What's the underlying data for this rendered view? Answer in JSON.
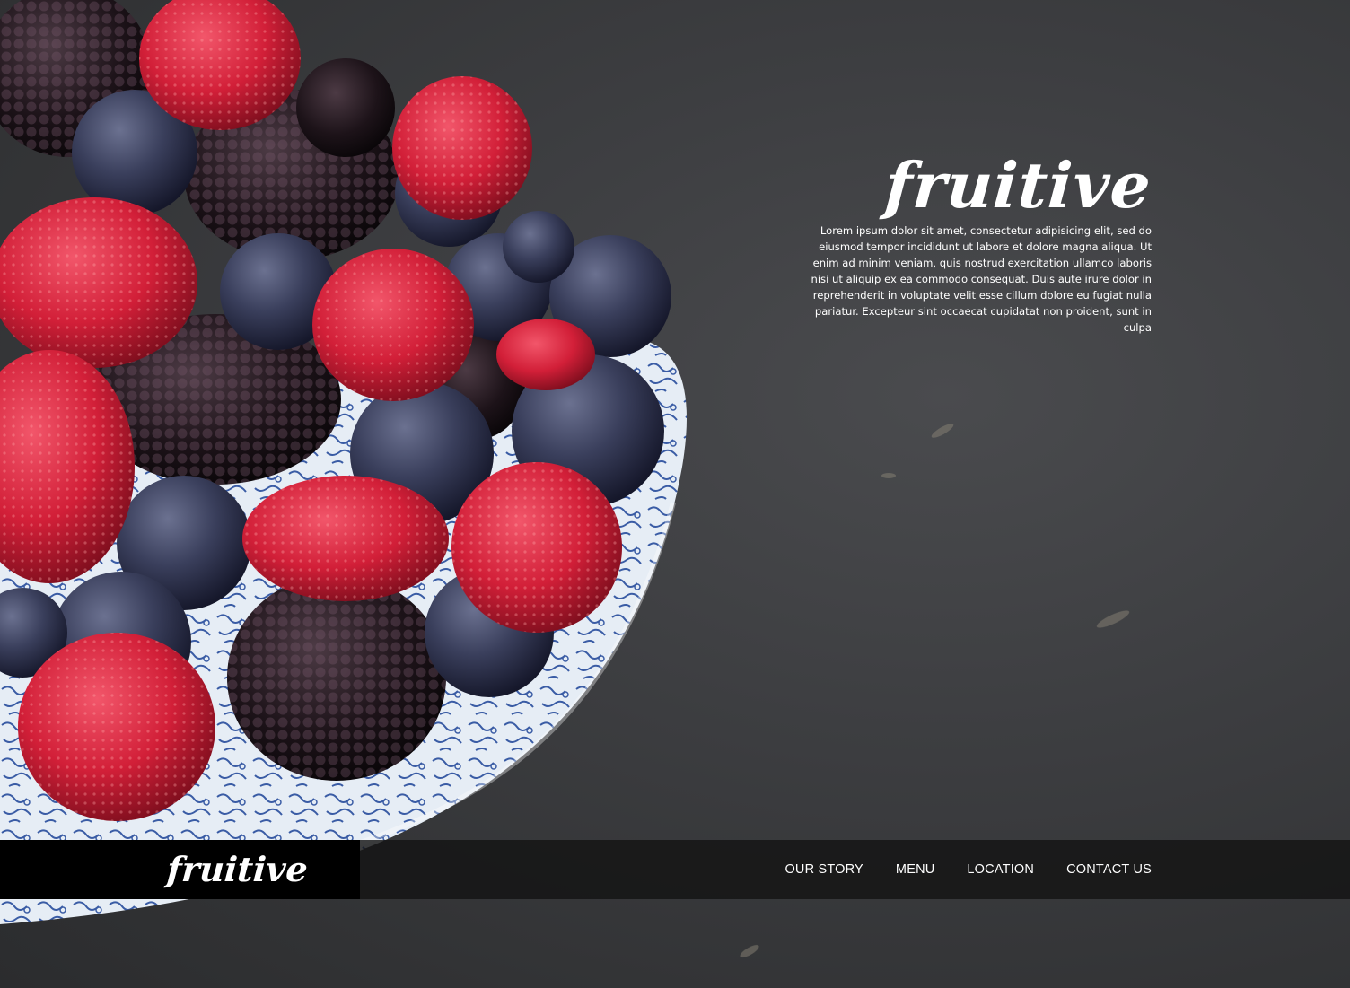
{
  "brand": {
    "name": "fruitive"
  },
  "hero": {
    "intro": "Lorem ipsum dolor sit amet, consectetur adipisicing elit, sed do eiusmod tempor incididunt ut labore et dolore magna aliqua. Ut enim ad minim veniam, quis nostrud exercitation ullamco laboris nisi ut aliquip ex ea commodo consequat. Duis aute irure dolor in reprehenderit in voluptate velit esse cillum dolore eu fugiat nulla pariatur. Excepteur sint occaecat cupidatat non proident, sunt in culpa"
  },
  "nav": {
    "items": [
      {
        "label": "OUR STORY"
      },
      {
        "label": "MENU"
      },
      {
        "label": "LOCATION"
      },
      {
        "label": "CONTACT US"
      }
    ]
  },
  "colors": {
    "background": "#3a3b3d",
    "navbar": "#141414",
    "text": "#ffffff",
    "raspberry": "#d4213a",
    "blueberry": "#2e3450",
    "blackberry": "#1a1218",
    "bowl": "#e8eef5",
    "bowl_pattern": "#3b5ea8"
  }
}
